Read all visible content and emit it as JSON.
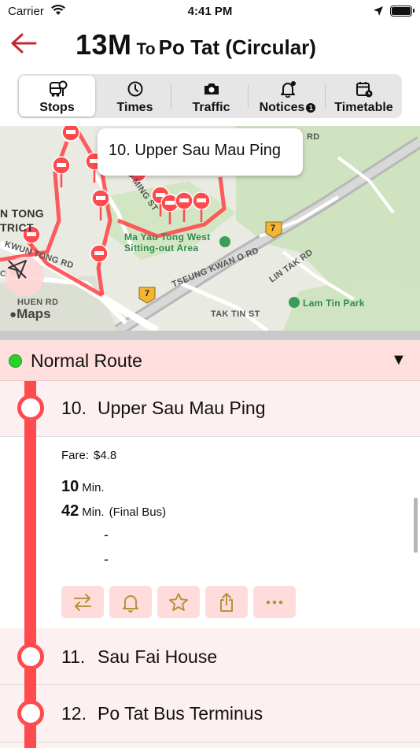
{
  "status_bar": {
    "carrier": "Carrier",
    "time": "4:41 PM"
  },
  "header": {
    "route": "13M",
    "to": "To",
    "destination": "Po Tat (Circular)"
  },
  "tabs": [
    {
      "label": "Stops",
      "icon": "bus-stop-icon",
      "active": true
    },
    {
      "label": "Times",
      "icon": "clock-icon",
      "active": false
    },
    {
      "label": "Traffic",
      "icon": "camera-icon",
      "active": false
    },
    {
      "label": "Notices",
      "icon": "bell-icon",
      "active": false,
      "badge": "1"
    },
    {
      "label": "Timetable",
      "icon": "calendar-icon",
      "active": false
    }
  ],
  "map": {
    "callout": "10. Upper Sau Mau Ping",
    "attribution": "Maps",
    "labels": {
      "place_1": "N TONG",
      "place_2": "TRICT",
      "park_1": "Ma Yau Tong West",
      "park_2": "Sitting-out Area",
      "road_1": "TSEUNG KWAN O RD",
      "road_2": "LIN TAK RD",
      "road_3": "TAK TIN ST",
      "road_4": "HIU MING ST",
      "road_5": "KWUN TONG RD",
      "road_6": "HUEN RD",
      "road_7": "O ST",
      "road_8": "RD",
      "park_3": "Lam Tin Park",
      "shield": "7"
    },
    "accent": "#ff4a4e"
  },
  "route": {
    "name": "Normal Route",
    "status_color": "#2bd22b",
    "toggle": "▼"
  },
  "stops": [
    {
      "number": "10.",
      "name": "Upper Sau Mau Ping",
      "expanded": true
    },
    {
      "number": "11.",
      "name": "Sau Fai House",
      "expanded": false
    },
    {
      "number": "12.",
      "name": "Po Tat Bus Terminus",
      "expanded": false
    }
  ],
  "detail": {
    "fare_label": "Fare:",
    "fare_value": "$4.8",
    "etas": [
      {
        "value": "10",
        "unit": "Min.",
        "note": ""
      },
      {
        "value": "42",
        "unit": "Min.",
        "note": "(Final Bus)"
      }
    ],
    "placeholders": [
      "-",
      "-"
    ],
    "actions": [
      "swap-icon",
      "bell-icon",
      "star-icon",
      "share-icon",
      "more-icon"
    ]
  }
}
